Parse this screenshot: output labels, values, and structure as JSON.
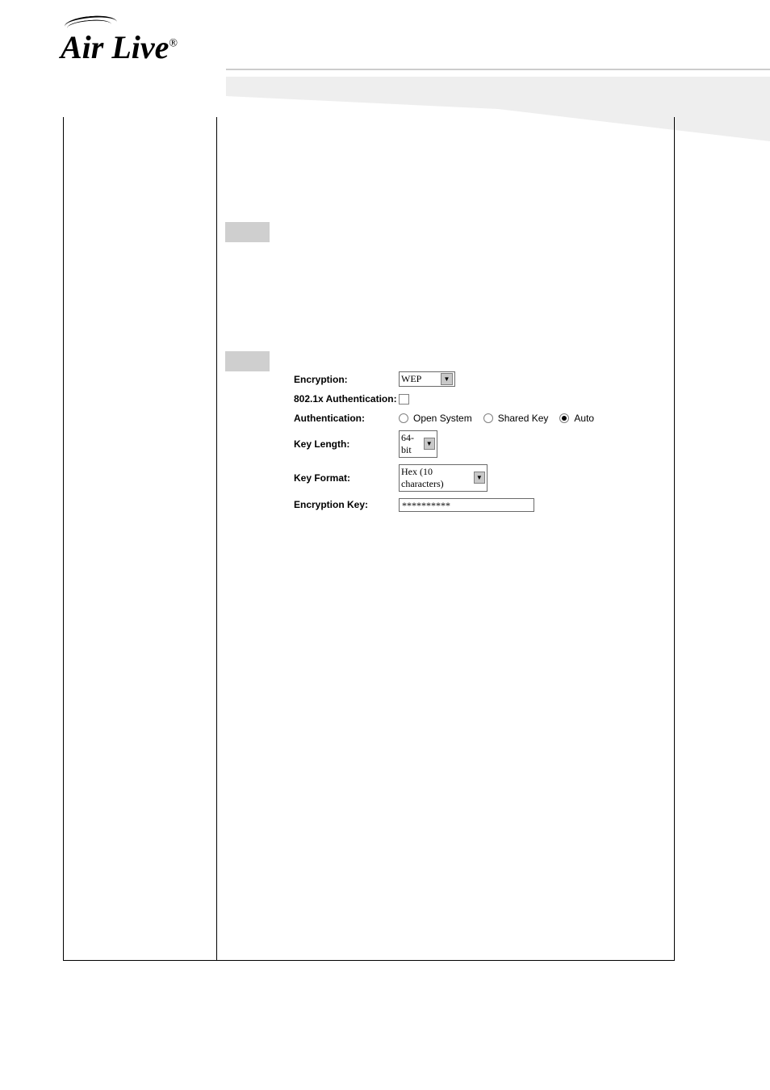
{
  "logo": {
    "brand": "Air Live",
    "registered": "®"
  },
  "form": {
    "encryption": {
      "label": "Encryption:",
      "value": "WEP"
    },
    "auth_8021x": {
      "label": "802.1x Authentication:",
      "checked": false
    },
    "authentication": {
      "label": "Authentication:",
      "options": {
        "open_system": "Open System",
        "shared_key": "Shared Key",
        "auto": "Auto"
      },
      "selected": "auto"
    },
    "key_length": {
      "label": "Key Length:",
      "value": "64-bit"
    },
    "key_format": {
      "label": "Key Format:",
      "value": "Hex (10 characters)"
    },
    "encryption_key": {
      "label": "Encryption Key:",
      "value": "**********"
    }
  }
}
